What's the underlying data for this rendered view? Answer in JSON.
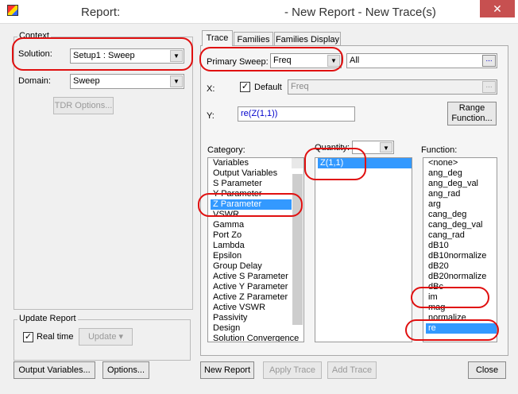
{
  "title": {
    "left": "Report:",
    "right": "- New Report - New Trace(s)",
    "close": "✕"
  },
  "context": {
    "legend": "Context",
    "solution_label": "Solution:",
    "solution_value": "Setup1 : Sweep",
    "domain_label": "Domain:",
    "domain_value": "Sweep",
    "tdr_button": "TDR Options..."
  },
  "update": {
    "legend": "Update Report",
    "realtime_label": "Real time",
    "realtime_checked": true,
    "update_button": "Update"
  },
  "tabs": [
    "Trace",
    "Families",
    "Families Display"
  ],
  "trace": {
    "primary_sweep_label": "Primary Sweep:",
    "primary_sweep_value": "Freq",
    "sweep_range": "All",
    "ellipsis": "...",
    "x_label": "X:",
    "default_label": "Default",
    "x_value": "Freq",
    "y_label": "Y:",
    "y_value": "re(Z(1,1))",
    "range_function_button_line1": "Range",
    "range_function_button_line2": "Function..."
  },
  "category": {
    "label": "Category:",
    "items": [
      "Variables",
      "Output Variables",
      "S Parameter",
      "Y Parameter",
      "Z Parameter",
      "VSWR",
      "Gamma",
      "Port Zo",
      "Lambda",
      "Epsilon",
      "Group Delay",
      "Active S Parameter",
      "Active Y Parameter",
      "Active Z Parameter",
      "Active VSWR",
      "Passivity",
      "Design",
      "Solution Convergence"
    ],
    "selected": "Z Parameter"
  },
  "quantity": {
    "label": "Quantity:",
    "items": [
      "Z(1,1)"
    ],
    "selected": "Z(1,1)"
  },
  "function": {
    "label": "Function:",
    "items": [
      "<none>",
      "ang_deg",
      "ang_deg_val",
      "ang_rad",
      "arg",
      "cang_deg",
      "cang_deg_val",
      "cang_rad",
      "dB10",
      "dB10normalize",
      "dB20",
      "dB20normalize",
      "dBc",
      "im",
      "mag",
      "normalize",
      "re"
    ],
    "selected": "re"
  },
  "bottom": {
    "output_variables": "Output Variables...",
    "options": "Options...",
    "new_report": "New Report",
    "apply_trace": "Apply Trace",
    "add_trace": "Add Trace",
    "close": "Close"
  }
}
